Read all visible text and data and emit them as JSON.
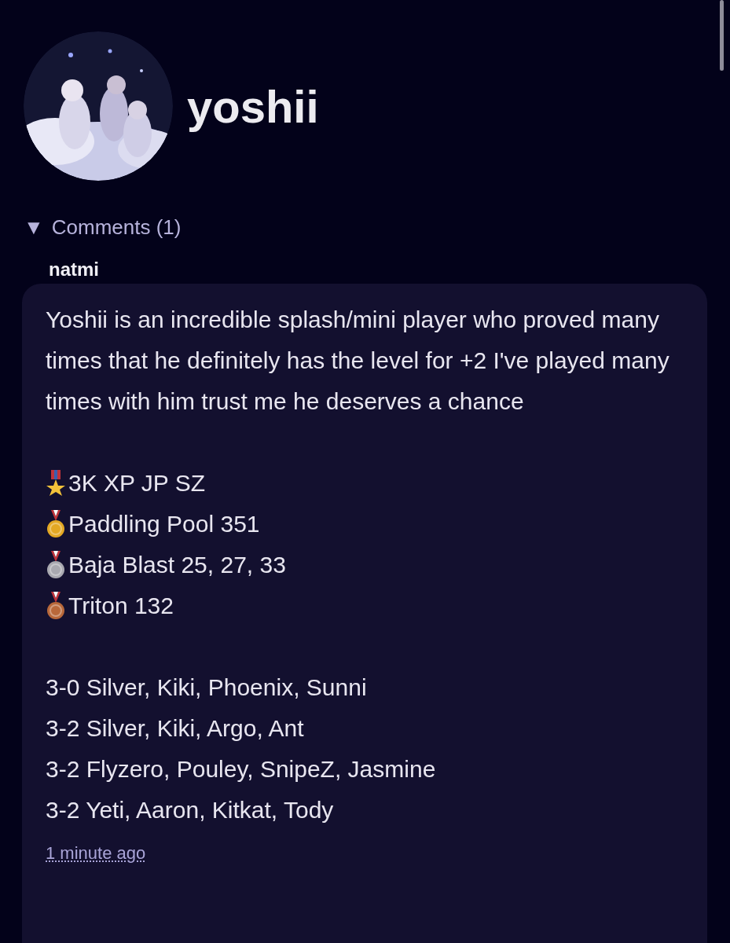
{
  "profile": {
    "username": "yoshii"
  },
  "comments": {
    "toggle": "▼",
    "label": "Comments (1)",
    "expanded": true,
    "items": [
      {
        "author": "natmi",
        "body": "Yoshii is an incredible splash/mini player who proved many times that he definitely has the level for +2 I've played many times with him trust me he deserves a chance",
        "achievements": [
          {
            "kind": "star",
            "text": "3K XP JP SZ"
          },
          {
            "kind": "gold",
            "text": "Paddling Pool 351"
          },
          {
            "kind": "silver",
            "text": "Baja Blast 25, 27, 33"
          },
          {
            "kind": "bronze",
            "text": "Triton 132"
          }
        ],
        "results": [
          "3-0 Silver, Kiki, Phoenix, Sunni",
          "3-2 Silver, Kiki, Argo, Ant",
          "3-2 Flyzero, Pouley, SnipeZ, Jasmine",
          "3-2 Yeti, Aaron, Kitkat, Tody"
        ],
        "time": "1 minute ago"
      }
    ]
  }
}
